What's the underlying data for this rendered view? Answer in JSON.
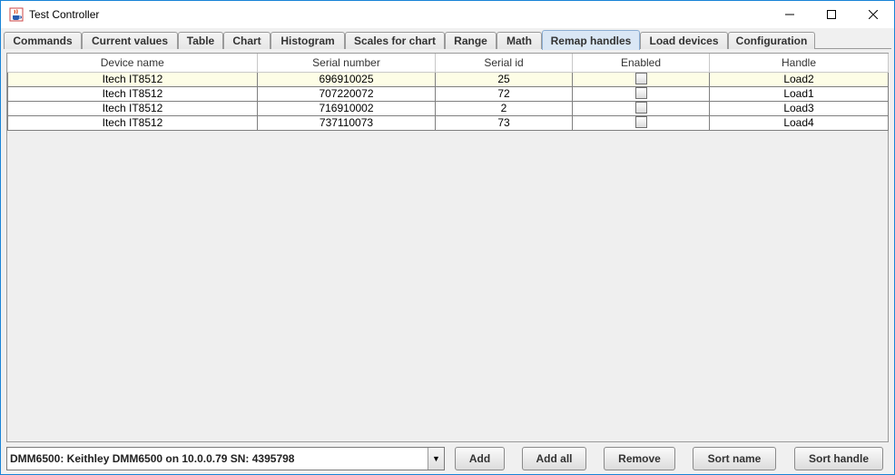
{
  "window": {
    "title": "Test Controller",
    "minimize_glyph": "—",
    "maximize_glyph": "☐",
    "close_glyph": "✕"
  },
  "tabs": [
    {
      "label": "Commands",
      "active": false
    },
    {
      "label": "Current values",
      "active": false
    },
    {
      "label": "Table",
      "active": false
    },
    {
      "label": "Chart",
      "active": false
    },
    {
      "label": "Histogram",
      "active": false
    },
    {
      "label": "Scales for chart",
      "active": false
    },
    {
      "label": "Range",
      "active": false
    },
    {
      "label": "Math",
      "active": false
    },
    {
      "label": "Remap handles",
      "active": true
    },
    {
      "label": "Load devices",
      "active": false
    },
    {
      "label": "Configuration",
      "active": false
    }
  ],
  "table": {
    "headers": [
      "Device name",
      "Serial number",
      "Serial id",
      "Enabled",
      "Handle"
    ],
    "rows": [
      {
        "device": "Itech IT8512",
        "serial": "696910025",
        "serial_id": "25",
        "enabled": false,
        "handle": "Load2",
        "selected": true
      },
      {
        "device": "Itech IT8512",
        "serial": "707220072",
        "serial_id": "72",
        "enabled": false,
        "handle": "Load1",
        "selected": false
      },
      {
        "device": "Itech IT8512",
        "serial": "716910002",
        "serial_id": "2",
        "enabled": false,
        "handle": "Load3",
        "selected": false
      },
      {
        "device": "Itech IT8512",
        "serial": "737110073",
        "serial_id": "73",
        "enabled": false,
        "handle": "Load4",
        "selected": false
      }
    ]
  },
  "bottom": {
    "device_select_value": "DMM6500: Keithley DMM6500 on 10.0.0.79  SN: 4395798",
    "arrow_glyph": "▼",
    "add_label": "Add",
    "add_all_label": "Add all",
    "remove_label": "Remove",
    "sort_name_label": "Sort name",
    "sort_handle_label": "Sort handle"
  },
  "colors": {
    "accent": "#1883d7",
    "active_tab": "#dae7f5",
    "selected_row": "#fdfde6"
  }
}
